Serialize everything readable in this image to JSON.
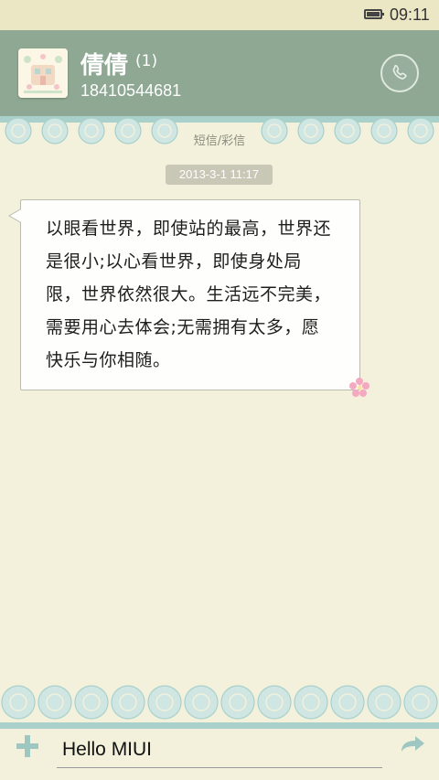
{
  "status_bar": {
    "time": "09:11",
    "battery_icon": "battery-icon"
  },
  "header": {
    "contact_name": "倩倩",
    "unread_count": "(1)",
    "phone": "18410544681",
    "call_icon": "phone-icon",
    "background": "#8ea893"
  },
  "thread": {
    "type_label": "短信/彩信",
    "timestamp": "2013-3-1 11:17",
    "message": "以眼看世界，即使站的最高，世界还是很小;以心看世界，即使身处局限，世界依然很大。生活远不完美，需要用心去体会;无需拥有太多，愿快乐与你相随。"
  },
  "composer": {
    "input_value": "Hello MIUI",
    "add_icon": "plus-icon",
    "send_icon": "send-arrow-icon"
  },
  "colors": {
    "accent": "#8ea893",
    "background": "#f3f1dc",
    "lace": "#a9d0cb"
  }
}
